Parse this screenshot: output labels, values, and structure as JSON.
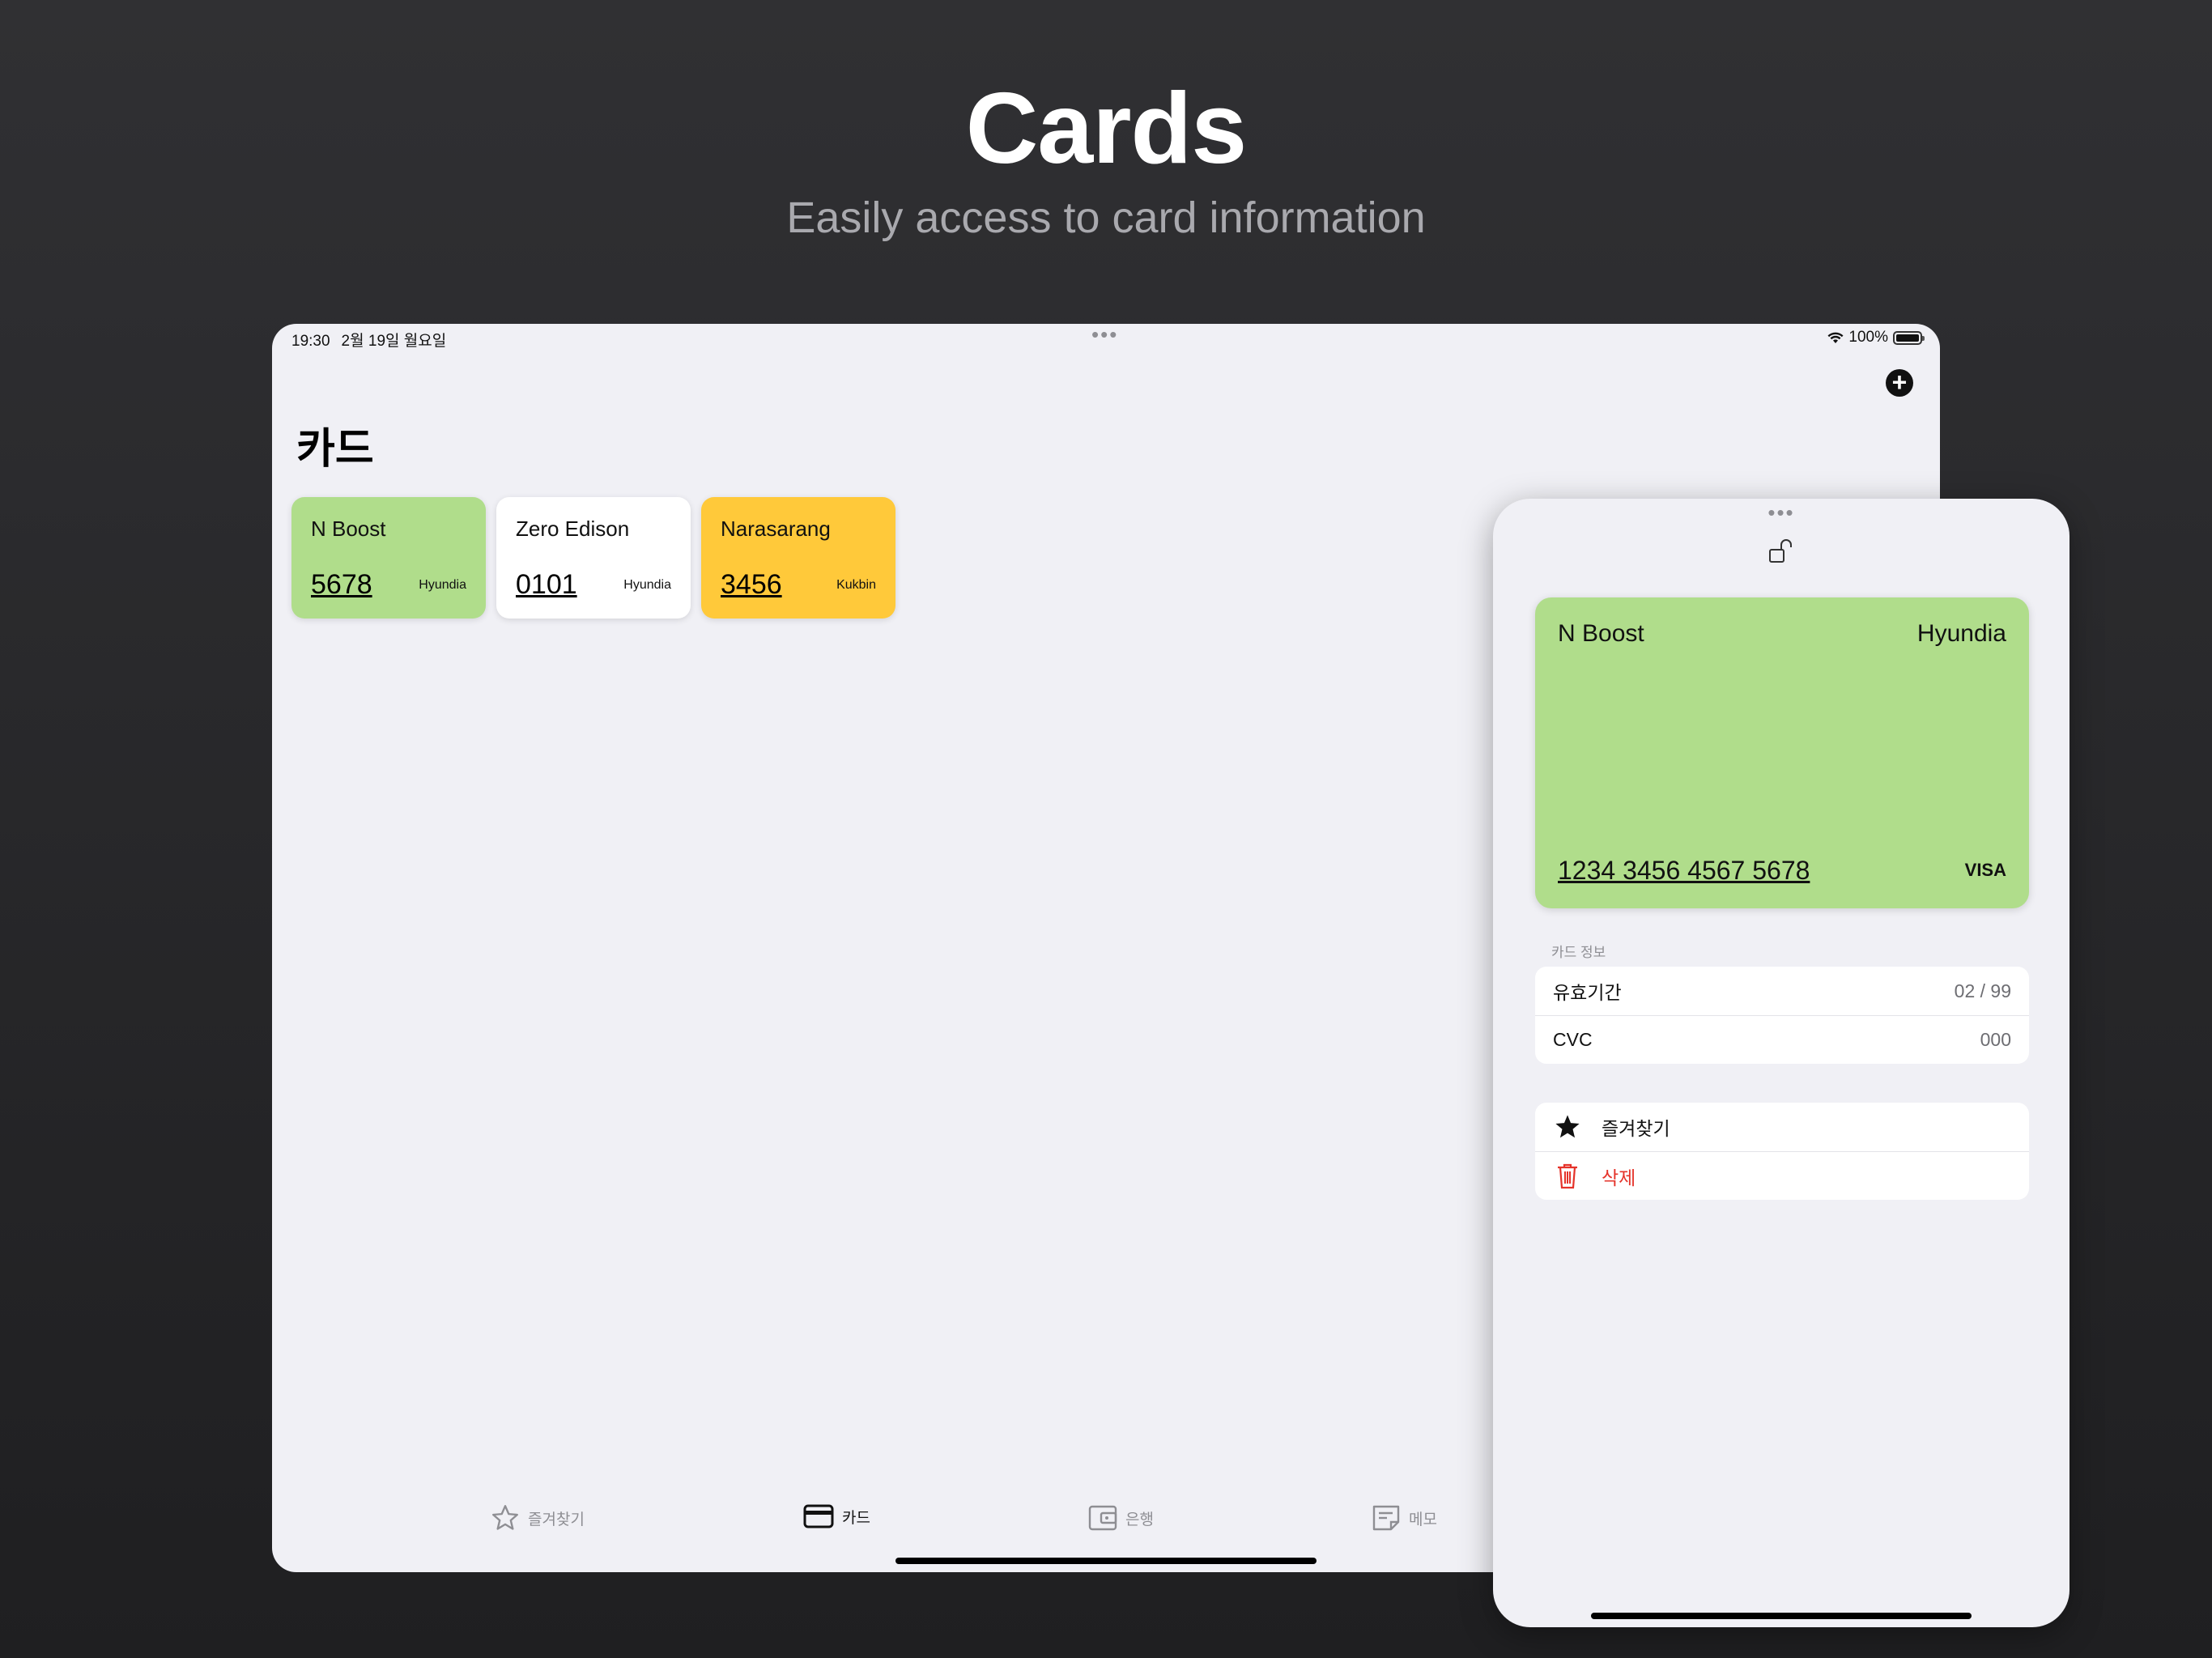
{
  "hero": {
    "title": "Cards",
    "subtitle": "Easily access to card information"
  },
  "status_bar": {
    "time": "19:30",
    "date": "2월 19일 월요일",
    "battery": "100%"
  },
  "main": {
    "page_title": "카드",
    "cards": [
      {
        "name": "N Boost",
        "number": "5678",
        "issuer": "Hyundia",
        "color": "#b0dd8b"
      },
      {
        "name": "Zero Edison",
        "number": "0101",
        "issuer": "Hyundia",
        "color": "#ffffff"
      },
      {
        "name": "Narasarang",
        "number": "3456",
        "issuer": "Kukbin",
        "color": "#ffc93a"
      }
    ]
  },
  "tabbar": {
    "tabs": [
      {
        "label": "즐겨찾기",
        "icon": "star-outline-icon",
        "active": false
      },
      {
        "label": "카드",
        "icon": "credit-card-icon",
        "active": true
      },
      {
        "label": "은행",
        "icon": "wallet-icon",
        "active": false
      },
      {
        "label": "메모",
        "icon": "note-icon",
        "active": false
      }
    ]
  },
  "detail": {
    "card": {
      "name": "N Boost",
      "issuer": "Hyundia",
      "number": "1234 3456 4567 5678",
      "brand": "VISA",
      "color": "#b0dd8b"
    },
    "section_title": "카드 정보",
    "info_rows": [
      {
        "label": "유효기간",
        "value": "02 / 99"
      },
      {
        "label": "CVC",
        "value": "000"
      }
    ],
    "actions": [
      {
        "label": "즐겨찾기",
        "icon": "star-filled-icon"
      },
      {
        "label": "삭제",
        "icon": "trash-icon",
        "color": "#e5332a"
      }
    ]
  }
}
